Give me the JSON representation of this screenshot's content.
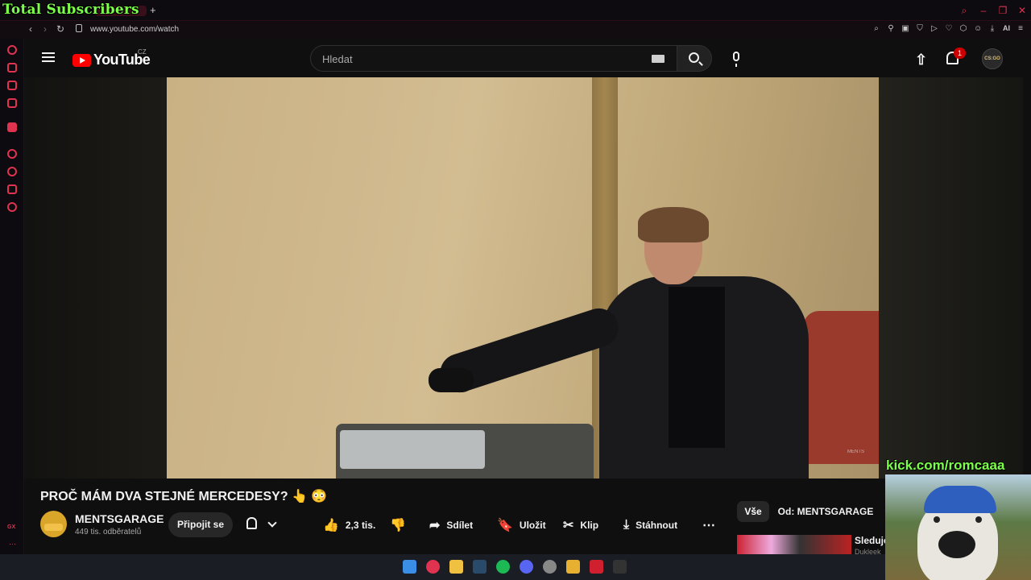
{
  "overlay": {
    "total_subscribers": "Total Subscribers",
    "kick": "kick.com/romcaaa"
  },
  "browser": {
    "url": "www.youtube.com/watch",
    "ai_label": "AI",
    "accent_color": "#e0334f",
    "gx_label": "GX"
  },
  "header": {
    "logo_text": "YouTube",
    "country_code": "CZ",
    "search_placeholder": "Hledat",
    "notification_count": "1",
    "avatar_label": "CS:GO"
  },
  "video": {
    "title": "PROČ MÁM DVA STEJNÉ MERCEDESY? 👆 😳",
    "watermark": "MENTS"
  },
  "channel": {
    "name": "MENTSGARAGE",
    "subscribers": "449 tis. odběratelů",
    "join_label": "Připojit se"
  },
  "actions": {
    "likes": "2,3 tis.",
    "share": "Sdílet",
    "save": "Uložit",
    "clip": "Klip",
    "download": "Stáhnout"
  },
  "sidebar_chips": {
    "all": "Vše",
    "from_channel": "Od: MENTSGARAGE"
  },
  "recommendation": {
    "title": "Sleduje",
    "subtitle": "Dukleek"
  }
}
